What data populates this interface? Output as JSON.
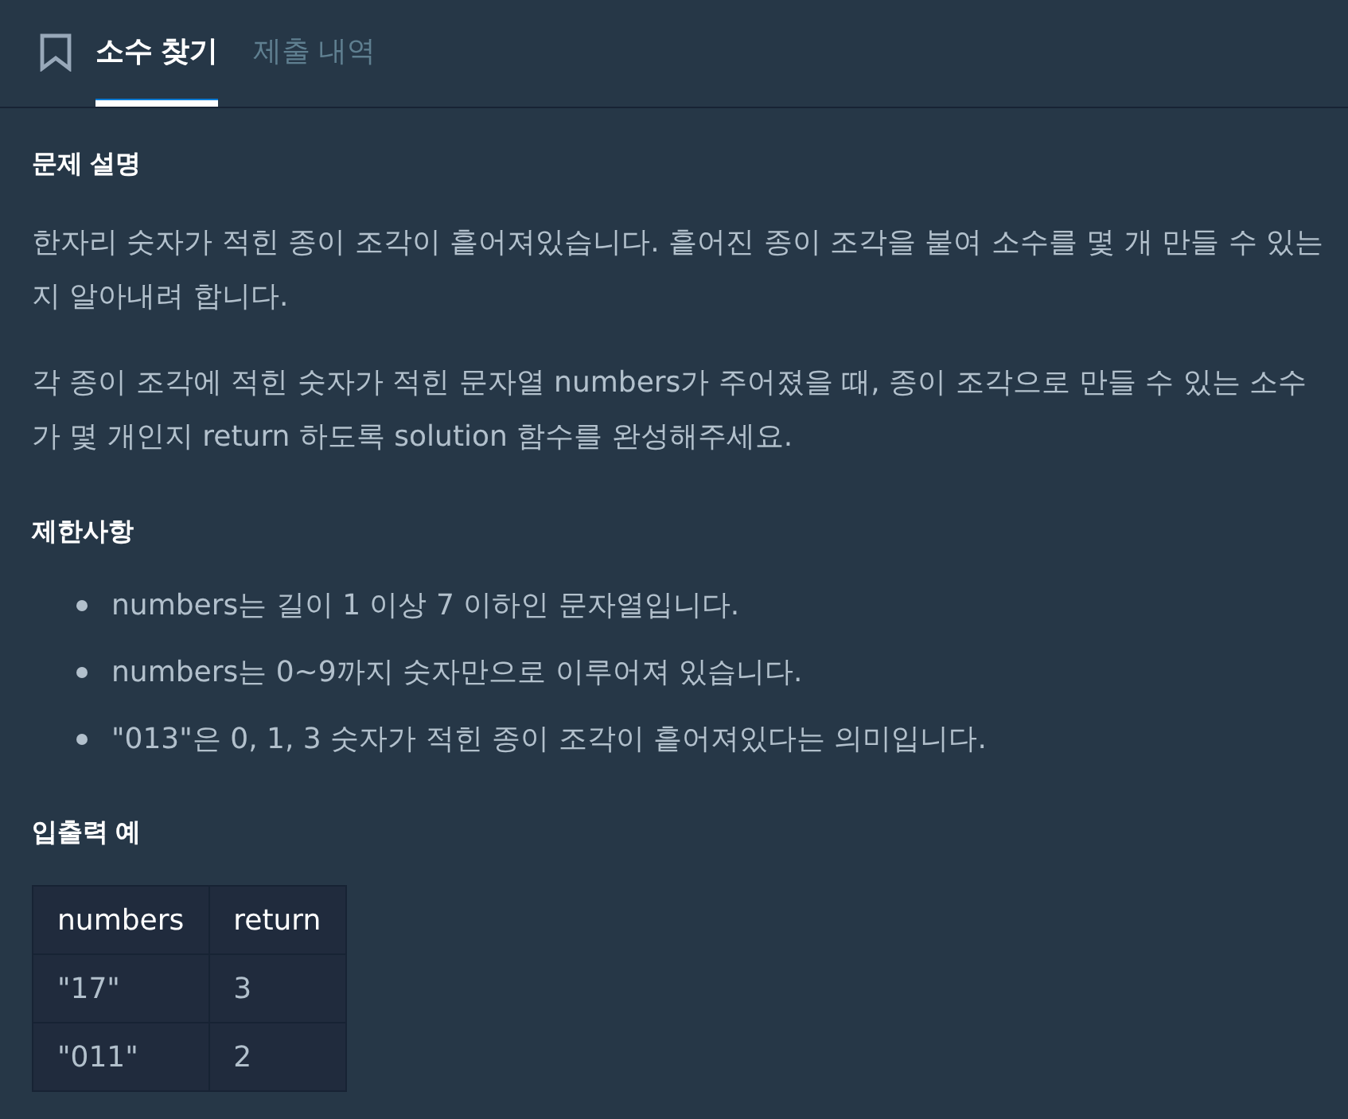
{
  "tabs": [
    {
      "label": "소수 찾기",
      "selected": true
    },
    {
      "label": "제출 내역",
      "selected": false
    }
  ],
  "sections": [
    {
      "kind": "paragraphs",
      "heading": "문제 설명",
      "paragraphs": [
        "한자리 숫자가 적힌 종이 조각이 흩어져있습니다. 흩어진 종이 조각을 붙여 소수를 몇 개 만들 수 있는지 알아내려 합니다.",
        "각 종이 조각에 적힌 숫자가 적힌 문자열 numbers가 주어졌을 때, 종이 조각으로 만들 수 있는 소수가 몇 개인지 return 하도록 solution 함수를 완성해주세요."
      ]
    },
    {
      "kind": "bullets",
      "heading": "제한사항",
      "items": [
        "numbers는 길이 1 이상 7 이하인 문자열입니다.",
        "numbers는 0~9까지 숫자만으로 이루어져 있습니다.",
        "\"013\"은 0, 1, 3 숫자가 적힌 종이 조각이 흩어져있다는 의미입니다."
      ]
    },
    {
      "kind": "table",
      "heading": "입출력 예",
      "columns": [
        "numbers",
        "return"
      ],
      "rows": [
        [
          "\"17\"",
          "3"
        ],
        [
          "\"011\"",
          "2"
        ]
      ]
    }
  ]
}
